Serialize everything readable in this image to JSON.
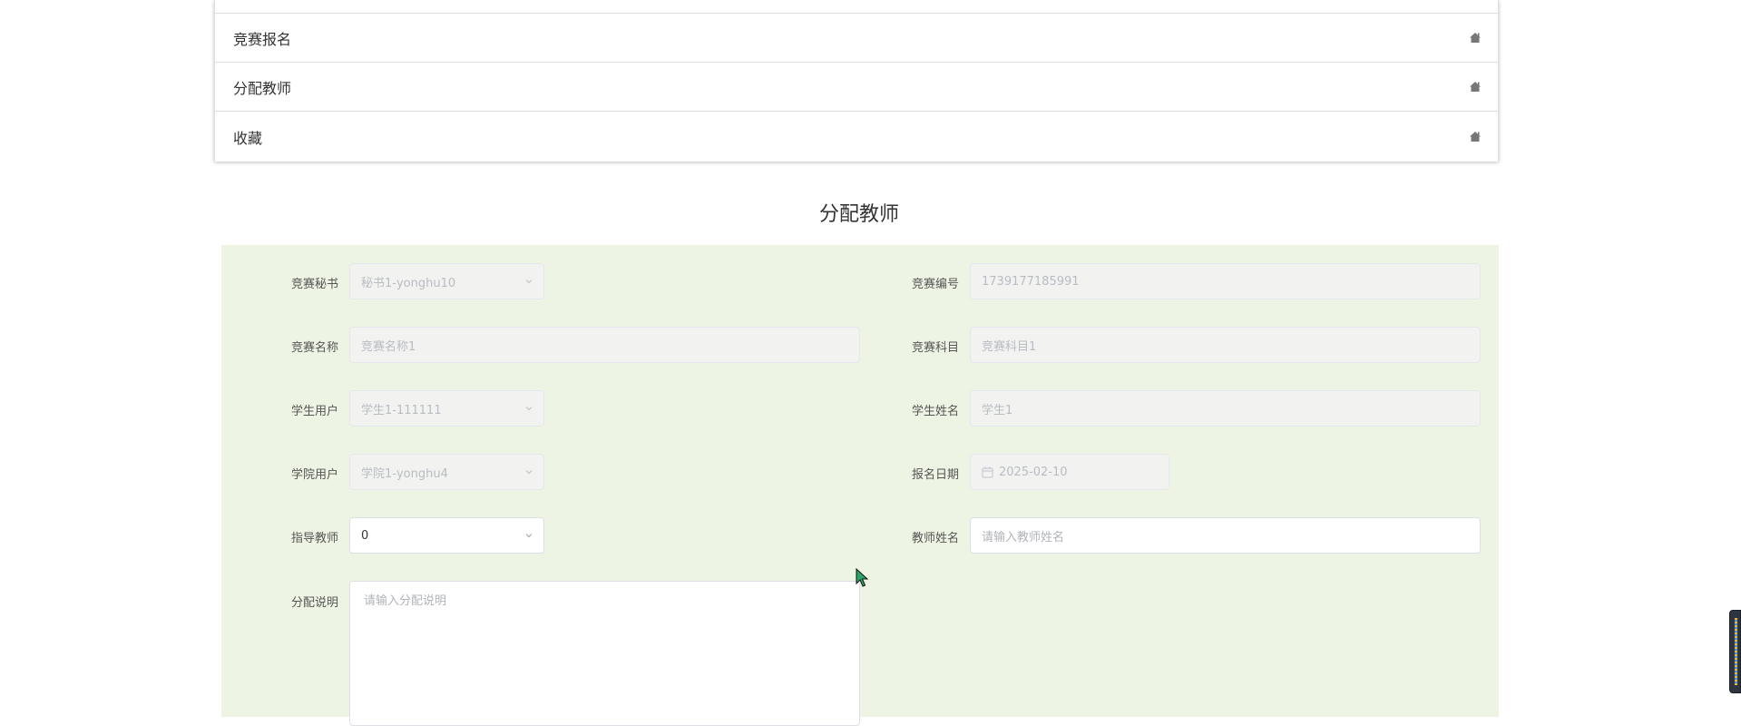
{
  "menu": {
    "items": [
      {
        "label": "竞赛报名"
      },
      {
        "label": "分配教师"
      },
      {
        "label": "收藏"
      }
    ]
  },
  "page_title": "分配教师",
  "form": {
    "secretary": {
      "label": "竞赛秘书",
      "value": "秘书1-yonghu10"
    },
    "competition_no": {
      "label": "竞赛编号",
      "value": "1739177185991"
    },
    "competition_name": {
      "label": "竞赛名称",
      "value": "竞赛名称1"
    },
    "competition_subject": {
      "label": "竞赛科目",
      "value": "竞赛科目1"
    },
    "student_user": {
      "label": "学生用户",
      "value": "学生1-111111"
    },
    "student_name": {
      "label": "学生姓名",
      "value": "学生1"
    },
    "college_user": {
      "label": "学院用户",
      "value": "学院1-yonghu4"
    },
    "signup_date": {
      "label": "报名日期",
      "value": "2025-02-10"
    },
    "advisor": {
      "label": "指导教师",
      "value": "0"
    },
    "teacher_name": {
      "label": "教师姓名",
      "placeholder": "请输入教师姓名"
    },
    "assign_note": {
      "label": "分配说明",
      "placeholder": "请输入分配说明"
    }
  },
  "colors": {
    "panel_bg": "#edf4e3",
    "disabled_bg": "#f2f3f0",
    "icon_gray": "#777777"
  },
  "icons": {
    "menu_item_icon": "home-icon",
    "select_caret": "chevron-down-icon",
    "date_icon": "calendar-icon"
  }
}
